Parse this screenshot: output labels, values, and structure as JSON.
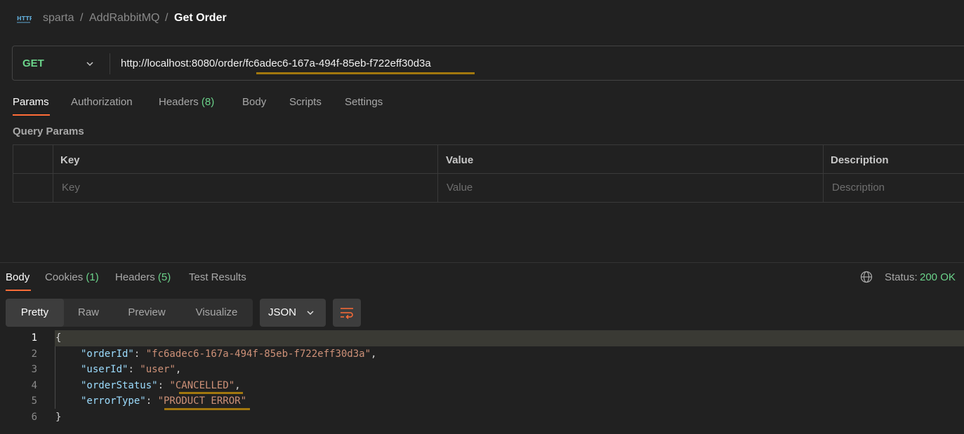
{
  "breadcrumb": {
    "icon": "http-icon",
    "items": [
      "sparta",
      "AddRabbitMQ",
      "Get Order"
    ],
    "separator": "/"
  },
  "request": {
    "method": "GET",
    "url_prefix": "http://localhost:8080/order/",
    "url_id": "fc6adec6-167a-494f-85eb-f722eff30d3a"
  },
  "request_tabs": [
    {
      "label": "Params",
      "count": ""
    },
    {
      "label": "Authorization",
      "count": ""
    },
    {
      "label": "Headers",
      "count": "(8)"
    },
    {
      "label": "Body",
      "count": ""
    },
    {
      "label": "Scripts",
      "count": ""
    },
    {
      "label": "Settings",
      "count": ""
    }
  ],
  "query_params": {
    "title": "Query Params",
    "headers": [
      "Key",
      "Value",
      "Description"
    ],
    "placeholders": [
      "Key",
      "Value",
      "Description"
    ]
  },
  "response": {
    "tabs": [
      {
        "label": "Body",
        "count": ""
      },
      {
        "label": "Cookies",
        "count": "(1)"
      },
      {
        "label": "Headers",
        "count": "(5)"
      },
      {
        "label": "Test Results",
        "count": ""
      }
    ],
    "status_label": "Status:",
    "status_value": "200 OK",
    "view_modes": [
      "Pretty",
      "Raw",
      "Preview",
      "Visualize"
    ],
    "format": "JSON"
  },
  "body": {
    "line_numbers": [
      "1",
      "2",
      "3",
      "4",
      "5",
      "6"
    ],
    "open_brace": "{",
    "close_brace": "}",
    "fields": [
      {
        "key": "\"orderId\"",
        "value": "\"fc6adec6-167a-494f-85eb-f722eff30d3a\"",
        "comma": ","
      },
      {
        "key": "\"userId\"",
        "value": "\"user\"",
        "comma": ","
      },
      {
        "key": "\"orderStatus\"",
        "value": "\"CANCELLED\"",
        "comma": ","
      },
      {
        "key": "\"errorType\"",
        "value": "\"PRODUCT ERROR\"",
        "comma": ""
      }
    ]
  },
  "colors": {
    "accent": "#ff6c37",
    "method_get": "#6bd38a",
    "highlight_marker": "#b8860b"
  }
}
